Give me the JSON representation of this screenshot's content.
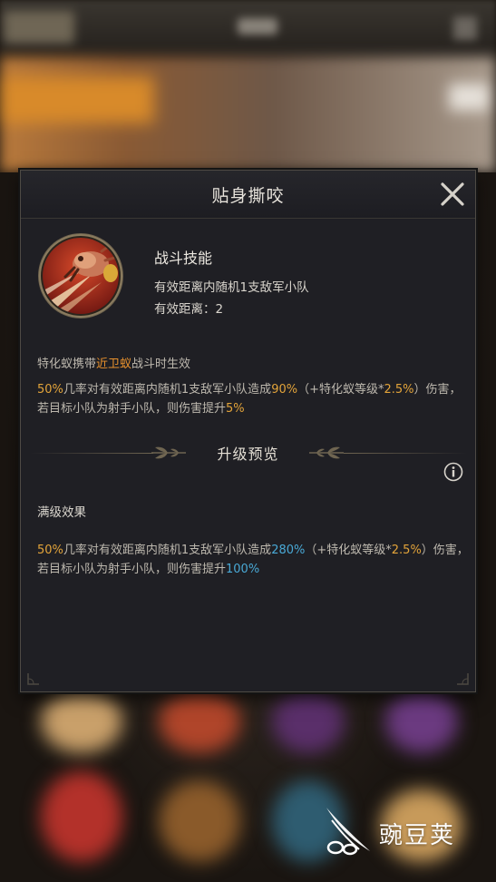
{
  "dialog": {
    "title": "贴身撕咬",
    "close_icon": "close-icon"
  },
  "skill": {
    "icon": "ant-bite-skill-icon",
    "type": "战斗技能",
    "description": "有效距离内随机1支敌军小队",
    "range_label": "有效距离：2"
  },
  "effect": {
    "condition_prefix": "特化蚁携带",
    "condition_highlight": "近卫蚁",
    "condition_suffix": "战斗时生效",
    "text": [
      {
        "t": "50%",
        "c": "o"
      },
      {
        "t": "几率对有效距离内随机1支敌军小队造成",
        "c": ""
      },
      {
        "t": "90%",
        "c": "o"
      },
      {
        "t": "（+特化蚁等级*",
        "c": ""
      },
      {
        "t": "2.5%",
        "c": "o"
      },
      {
        "t": "）伤害，若目标小队为射手小队，则伤害提升",
        "c": ""
      },
      {
        "t": "5%",
        "c": "o"
      }
    ]
  },
  "upgrade": {
    "heading": "升级预览",
    "info_icon": "info-icon",
    "max_label": "满级效果",
    "text": [
      {
        "t": "50%",
        "c": "o"
      },
      {
        "t": "几率对有效距离内随机1支敌军小队造成",
        "c": ""
      },
      {
        "t": "280%",
        "c": "b"
      },
      {
        "t": "（+特化蚁等级*",
        "c": ""
      },
      {
        "t": "2.5%",
        "c": "o"
      },
      {
        "t": "）伤害，若目标小队为射手小队，则伤害提升",
        "c": ""
      },
      {
        "t": "100%",
        "c": "b"
      }
    ]
  },
  "colors": {
    "orange_highlight": "#e3a43a",
    "blue_highlight": "#49a9d6",
    "troop_highlight": "#e8912d"
  },
  "watermark": {
    "text": "豌豆荚",
    "icon": "wandoujia-logo-icon"
  }
}
